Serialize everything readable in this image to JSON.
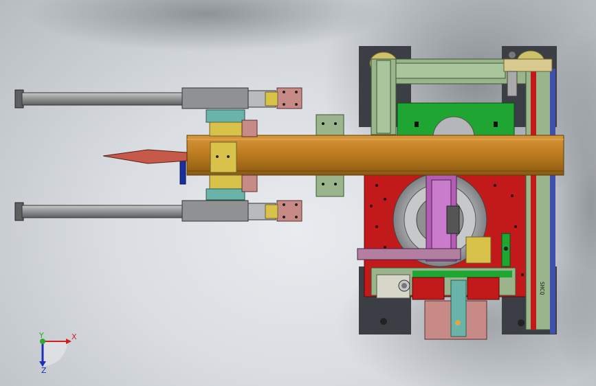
{
  "viewport": {
    "background_color": "#dadee2",
    "background_shadow_color": "#4a4f55"
  },
  "triad": {
    "x_label": "X",
    "y_label": "Y",
    "z_label": "Z",
    "x_color": "#d21e1e",
    "y_color": "#2ea82e",
    "z_color": "#1f2fb5"
  },
  "palette": {
    "beam_orange": "#b97a1d",
    "frame_red": "#c21a1a",
    "rail_green": "#9ab58b",
    "plate_green": "#1fa532",
    "cylinder_grey": "#8f9193",
    "bracket_pink": "#c88a87",
    "yellow_block": "#d8c24a",
    "teal_block": "#69b3a8",
    "purple_block": "#b35cb6",
    "navy_bracket": "#1b2f9a",
    "dark_base": "#3b3e44",
    "magenta_tip": "#c65a4a"
  },
  "part_labels": {
    "vertical_rail_text": "SHCQ"
  }
}
